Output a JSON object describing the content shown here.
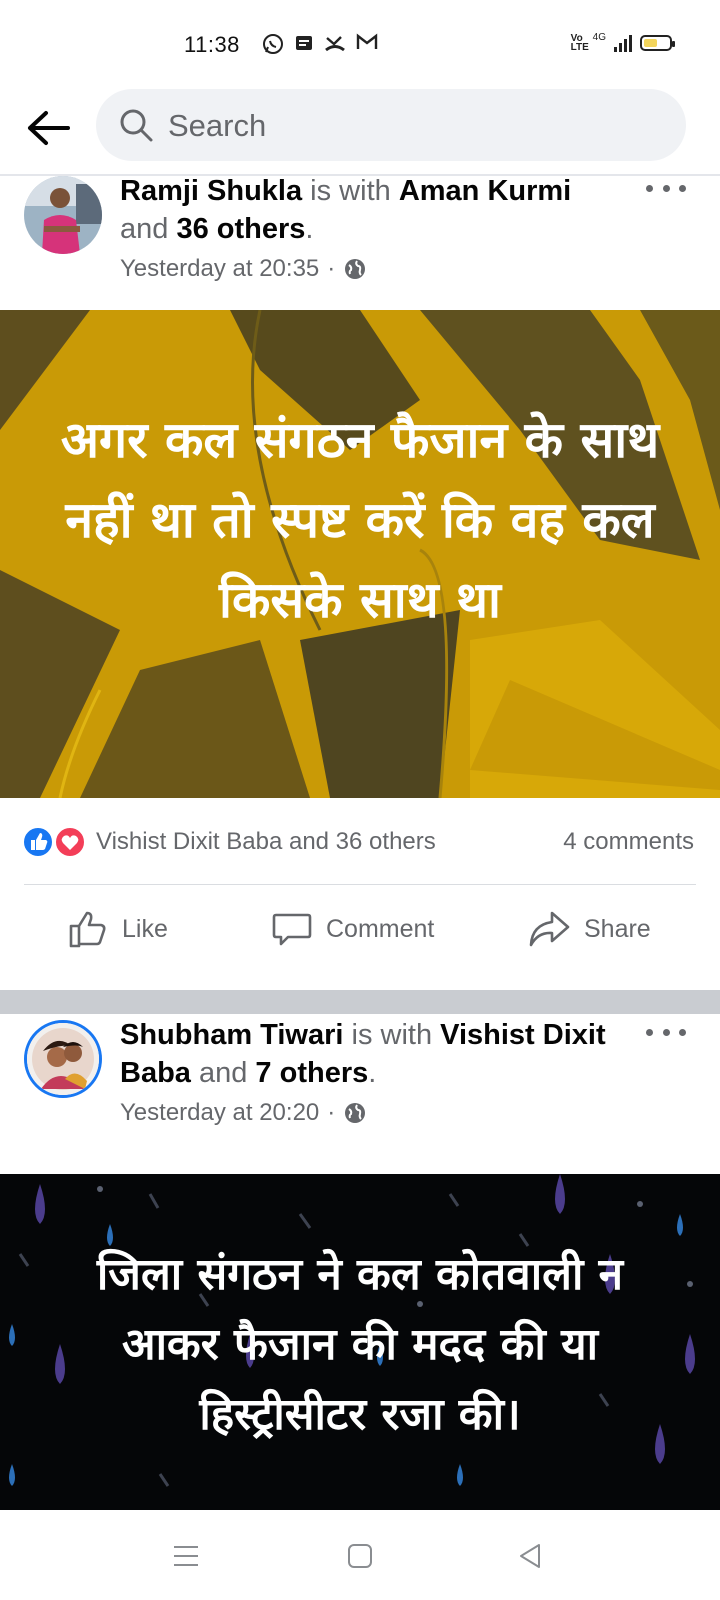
{
  "status_bar": {
    "time": "11:38",
    "network": "4G",
    "volte": "Vo LTE",
    "notification_icons": [
      "whatsapp-icon",
      "message-icon",
      "missed-call-icon",
      "gmail-icon"
    ],
    "battery_level": 0.55
  },
  "search": {
    "placeholder": "Search"
  },
  "posts": [
    {
      "author": "Ramji Shukla",
      "with_word": " is with ",
      "tagged": "Aman Kurmi",
      "and_word": " and ",
      "others": "36 others",
      "end": ".",
      "time": "Yesterday at 20:35",
      "dot": "·",
      "privacy_icon": "globe-icon",
      "banner_text": "अगर कल संगठन फैजान के साथ नहीं था तो  स्पष्ट करें कि वह कल किसके साथ था",
      "reactions": [
        "like",
        "love"
      ],
      "reaction_text": "Vishist Dixit Baba and 36 others",
      "comments": "4 comments"
    },
    {
      "author": "Shubham Tiwari",
      "with_word": " is with ",
      "tagged": "Vishist Dixit Baba",
      "and_word": " and ",
      "others": "7 others",
      "end": ".",
      "time": "Yesterday at 20:20",
      "dot": "·",
      "privacy_icon": "globe-icon",
      "banner_text": "जिला संगठन ने कल कोतवाली न आकर फैजान की मदद की या हिस्ट्रीसीटर रजा की।"
    }
  ],
  "actions": {
    "like": "Like",
    "comment": "Comment",
    "share": "Share"
  },
  "colors": {
    "accent": "#1877f2",
    "banner1": "#c99a06",
    "banner2": "#050608",
    "love": "#f33e58"
  }
}
